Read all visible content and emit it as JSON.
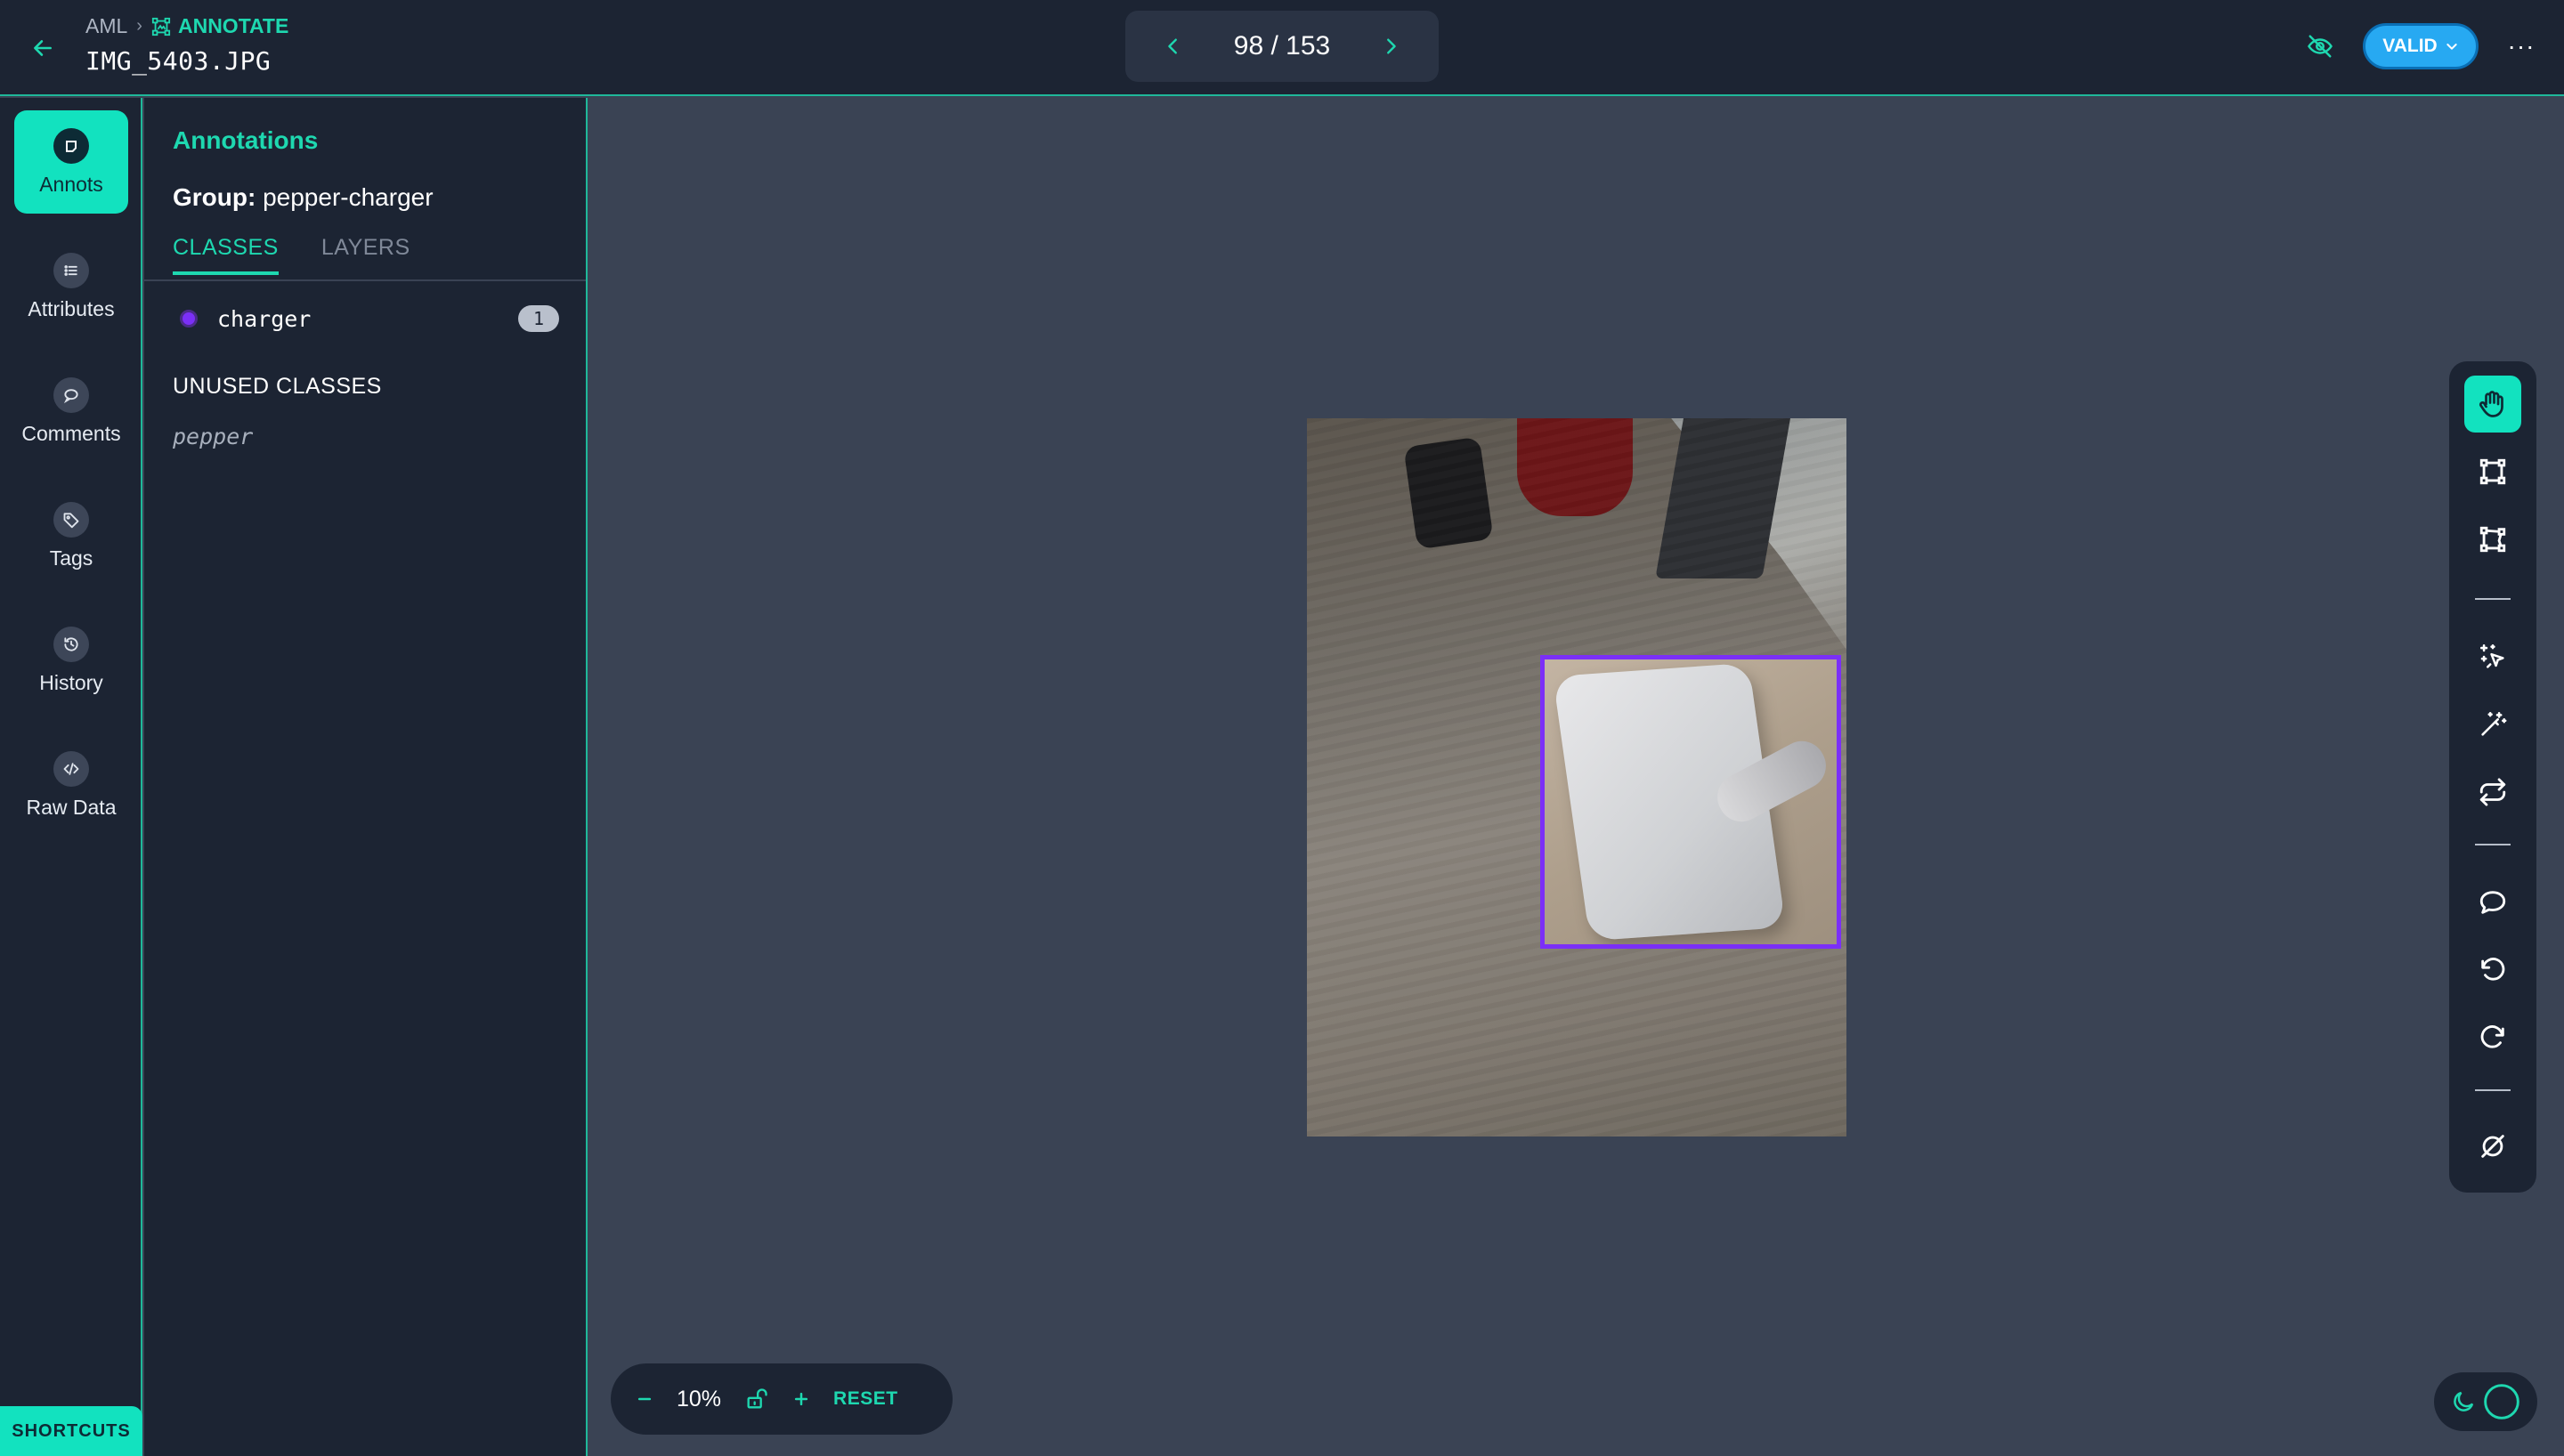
{
  "header": {
    "breadcrumb_root": "AML",
    "breadcrumb_current": "ANNOTATE",
    "file_name": "IMG_5403.JPG",
    "pager": {
      "current": 98,
      "total": 153,
      "text": "98 / 153"
    },
    "status_label": "VALID",
    "colors": {
      "accent": "#1ed8b0",
      "status": "#27a9f2",
      "background": "#1c2433"
    }
  },
  "nav": {
    "items": [
      {
        "label": "Annots",
        "icon": "annotation-icon",
        "active": true
      },
      {
        "label": "Attributes",
        "icon": "list-icon"
      },
      {
        "label": "Comments",
        "icon": "comment-icon"
      },
      {
        "label": "Tags",
        "icon": "tag-icon"
      },
      {
        "label": "History",
        "icon": "history-icon"
      },
      {
        "label": "Raw Data",
        "icon": "code-icon"
      }
    ],
    "shortcuts_label": "SHORTCUTS"
  },
  "panel": {
    "title": "Annotations",
    "group_prefix": "Group:",
    "group_name": "pepper-charger",
    "tabs": [
      {
        "label": "CLASSES",
        "active": true
      },
      {
        "label": "LAYERS"
      }
    ],
    "classes": [
      {
        "name": "charger",
        "count": "1",
        "color": "#7b2ff7"
      }
    ],
    "unused_heading": "UNUSED CLASSES",
    "unused": [
      "pepper"
    ]
  },
  "toolbar": {
    "tools": [
      "hand-icon",
      "bounding-box-icon",
      "polygon-icon",
      "magic-select-icon",
      "magic-wand-icon",
      "repeat-icon",
      "comment-icon",
      "undo-icon",
      "redo-icon",
      "clear-icon"
    ],
    "active_tool": "hand-icon"
  },
  "zoom": {
    "value": "10%",
    "reset_label": "RESET"
  }
}
